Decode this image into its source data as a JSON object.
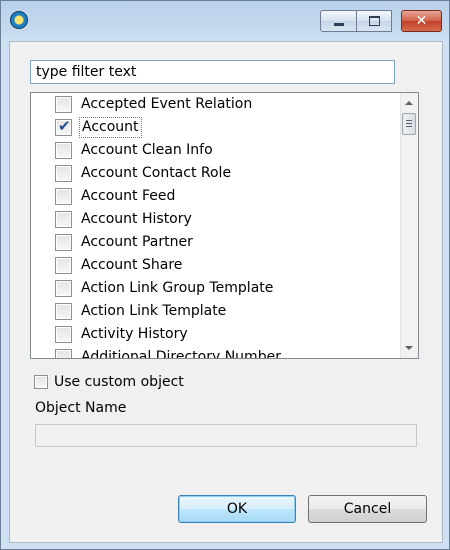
{
  "window": {
    "title": "",
    "controls": {
      "minimize": "minimize",
      "maximize": "maximize",
      "close": "close"
    },
    "close_glyph": "✕"
  },
  "filter": {
    "value": "type filter text",
    "placeholder": "type filter text"
  },
  "list": {
    "items": [
      {
        "label": "Accepted Event Relation",
        "checked": false
      },
      {
        "label": "Account",
        "checked": true
      },
      {
        "label": "Account Clean Info",
        "checked": false
      },
      {
        "label": "Account Contact Role",
        "checked": false
      },
      {
        "label": "Account Feed",
        "checked": false
      },
      {
        "label": "Account History",
        "checked": false
      },
      {
        "label": "Account Partner",
        "checked": false
      },
      {
        "label": "Account Share",
        "checked": false
      },
      {
        "label": "Action Link Group Template",
        "checked": false
      },
      {
        "label": "Action Link Template",
        "checked": false
      },
      {
        "label": "Activity History",
        "checked": false
      },
      {
        "label": "Additional Directory Number",
        "checked": false
      }
    ],
    "selected_index": 1
  },
  "custom": {
    "label": "Use custom object",
    "checked": false
  },
  "object_name": {
    "label": "Object Name",
    "value": ""
  },
  "buttons": {
    "ok": "OK",
    "cancel": "Cancel"
  },
  "colors": {
    "title_gradient": "#b9d1ea",
    "close_button": "#c2412a",
    "ok_border": "#3c7fb1",
    "check_mark": "#2a4c8f"
  }
}
